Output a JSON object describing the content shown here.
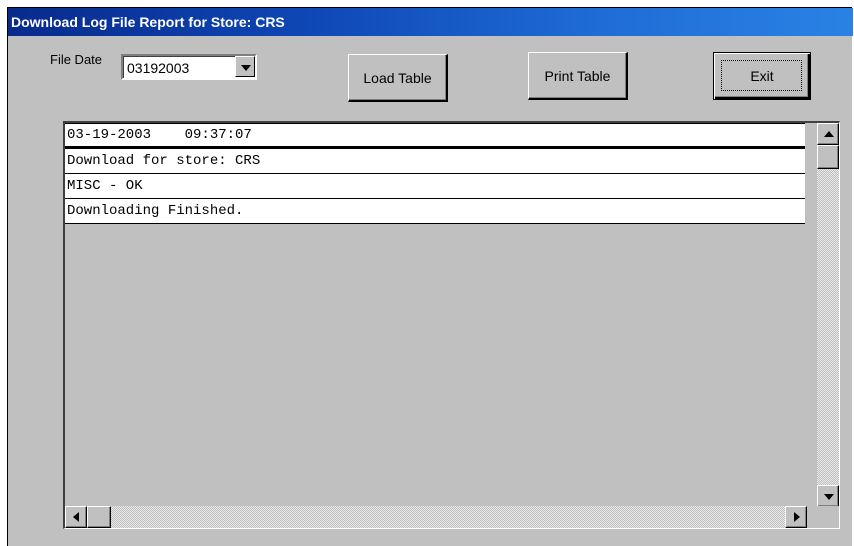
{
  "window": {
    "title": "Download Log File Report for Store:  CRS"
  },
  "controls": {
    "file_date_label": "File Date",
    "file_date_value": "03192003",
    "load_table_label": "Load Table",
    "print_table_label": "Print Table",
    "exit_label": "Exit"
  },
  "log": {
    "rows": [
      "03-19-2003    09:37:07",
      "Download for store: CRS",
      "MISC - OK",
      "Downloading Finished."
    ]
  },
  "colors": {
    "titlebar_start": "#082a8c",
    "titlebar_end": "#2a82e4",
    "face": "#c0c0c0"
  },
  "icons": {
    "dropdown": "chevron-down-icon",
    "scroll_up": "arrow-up-icon",
    "scroll_down": "arrow-down-icon",
    "scroll_left": "arrow-left-icon",
    "scroll_right": "arrow-right-icon"
  }
}
